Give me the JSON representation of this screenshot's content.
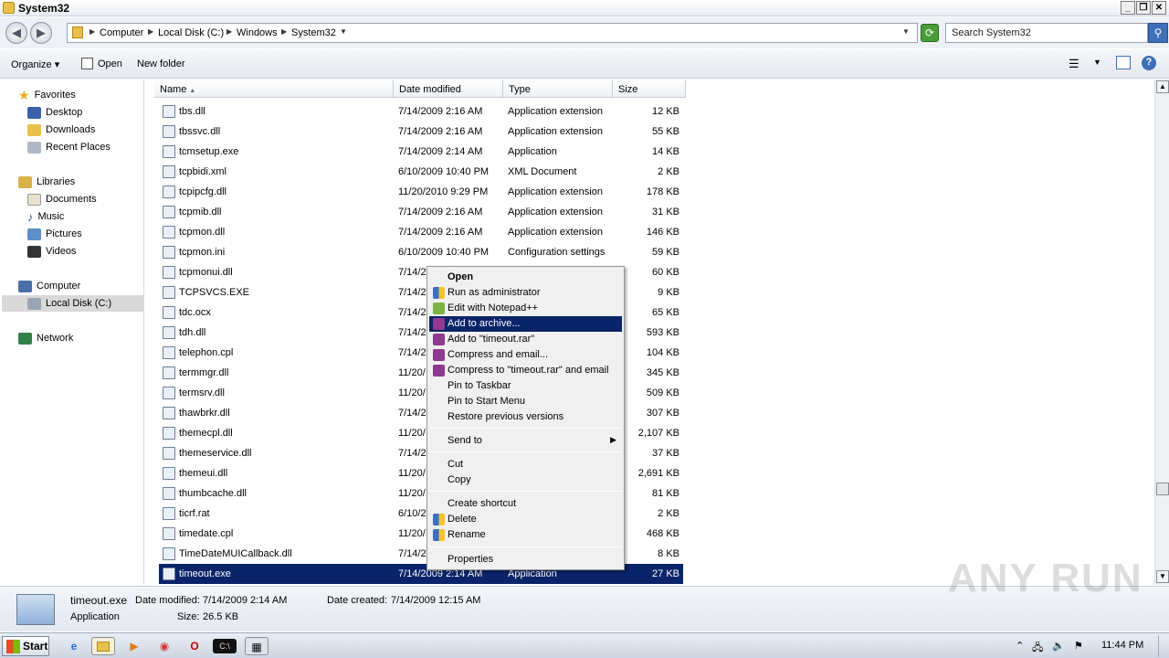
{
  "window": {
    "title": "System32"
  },
  "address": {
    "crumbs": [
      "Computer",
      "Local Disk (C:)",
      "Windows",
      "System32"
    ],
    "search_placeholder": "Search System32"
  },
  "toolbar": {
    "organize": "Organize",
    "open": "Open",
    "new_folder": "New folder"
  },
  "nav": {
    "favorites": "Favorites",
    "desktop": "Desktop",
    "downloads": "Downloads",
    "recent": "Recent Places",
    "libraries": "Libraries",
    "documents": "Documents",
    "music": "Music",
    "pictures": "Pictures",
    "videos": "Videos",
    "computer": "Computer",
    "localdisk": "Local Disk (C:)",
    "network": "Network"
  },
  "columns": {
    "name": "Name",
    "date": "Date modified",
    "type": "Type",
    "size": "Size"
  },
  "files": [
    {
      "name": "tbs.dll",
      "date": "7/14/2009 2:16 AM",
      "type": "Application extension",
      "size": "12 KB"
    },
    {
      "name": "tbssvc.dll",
      "date": "7/14/2009 2:16 AM",
      "type": "Application extension",
      "size": "55 KB"
    },
    {
      "name": "tcmsetup.exe",
      "date": "7/14/2009 2:14 AM",
      "type": "Application",
      "size": "14 KB"
    },
    {
      "name": "tcpbidi.xml",
      "date": "6/10/2009 10:40 PM",
      "type": "XML Document",
      "size": "2 KB"
    },
    {
      "name": "tcpipcfg.dll",
      "date": "11/20/2010 9:29 PM",
      "type": "Application extension",
      "size": "178 KB"
    },
    {
      "name": "tcpmib.dll",
      "date": "7/14/2009 2:16 AM",
      "type": "Application extension",
      "size": "31 KB"
    },
    {
      "name": "tcpmon.dll",
      "date": "7/14/2009 2:16 AM",
      "type": "Application extension",
      "size": "146 KB"
    },
    {
      "name": "tcpmon.ini",
      "date": "6/10/2009 10:40 PM",
      "type": "Configuration settings",
      "size": "59 KB"
    },
    {
      "name": "tcpmonui.dll",
      "date": "7/14/2",
      "type": "",
      "size": "60 KB"
    },
    {
      "name": "TCPSVCS.EXE",
      "date": "7/14/2",
      "type": "",
      "size": "9 KB"
    },
    {
      "name": "tdc.ocx",
      "date": "7/14/2",
      "type": "",
      "size": "65 KB"
    },
    {
      "name": "tdh.dll",
      "date": "7/14/2",
      "type": "",
      "size": "593 KB"
    },
    {
      "name": "telephon.cpl",
      "date": "7/14/2",
      "type": "",
      "size": "104 KB"
    },
    {
      "name": "termmgr.dll",
      "date": "11/20/",
      "type": "",
      "size": "345 KB"
    },
    {
      "name": "termsrv.dll",
      "date": "11/20/",
      "type": "",
      "size": "509 KB"
    },
    {
      "name": "thawbrkr.dll",
      "date": "7/14/2",
      "type": "",
      "size": "307 KB"
    },
    {
      "name": "themecpl.dll",
      "date": "11/20/",
      "type": "",
      "size": "2,107 KB"
    },
    {
      "name": "themeservice.dll",
      "date": "7/14/2",
      "type": "",
      "size": "37 KB"
    },
    {
      "name": "themeui.dll",
      "date": "11/20/",
      "type": "",
      "size": "2,691 KB"
    },
    {
      "name": "thumbcache.dll",
      "date": "11/20/",
      "type": "",
      "size": "81 KB"
    },
    {
      "name": "ticrf.rat",
      "date": "6/10/2",
      "type": "",
      "size": "2 KB"
    },
    {
      "name": "timedate.cpl",
      "date": "11/20/",
      "type": "",
      "size": "468 KB"
    },
    {
      "name": "TimeDateMUICallback.dll",
      "date": "7/14/2",
      "type": "",
      "size": "8 KB"
    },
    {
      "name": "timeout.exe",
      "date": "7/14/2009 2:14 AM",
      "type": "Application",
      "size": "27 KB"
    }
  ],
  "context_menu": {
    "open": "Open",
    "runas": "Run as administrator",
    "notepad": "Edit with Notepad++",
    "archive": "Add to archive...",
    "addrar": "Add to \"timeout.rar\"",
    "compress": "Compress and email...",
    "compressrar": "Compress to \"timeout.rar\" and email",
    "taskbar": "Pin to Taskbar",
    "startmenu": "Pin to Start Menu",
    "restore": "Restore previous versions",
    "sendto": "Send to",
    "cut": "Cut",
    "copy": "Copy",
    "shortcut": "Create shortcut",
    "delete": "Delete",
    "rename": "Rename",
    "properties": "Properties"
  },
  "details": {
    "name": "timeout.exe",
    "modified_label": "Date modified:",
    "modified": "7/14/2009 2:14 AM",
    "created_label": "Date created:",
    "created": "7/14/2009 12:15 AM",
    "type": "Application",
    "size_label": "Size:",
    "size": "26.5 KB"
  },
  "taskbar": {
    "start": "Start",
    "clock": "11:44 PM"
  },
  "watermark": "ANY RUN"
}
